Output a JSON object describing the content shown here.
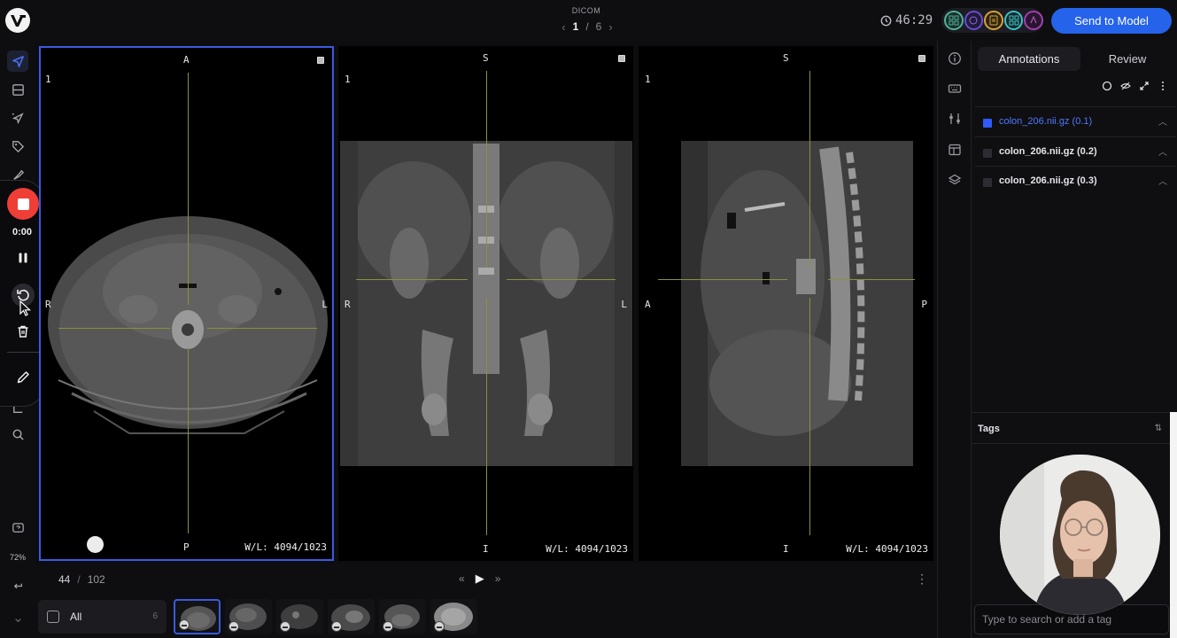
{
  "header": {
    "modality": "DICOM",
    "page_current": "1",
    "page_separator": "/",
    "page_total": "6",
    "timer": "46:29",
    "send_button": "Send to Model"
  },
  "recorder": {
    "time": "0:00"
  },
  "left_toolbar": {
    "zoom": "72%"
  },
  "viewports": [
    {
      "top": "A",
      "bottom": "P",
      "left": "R",
      "right": "L",
      "index": "1",
      "wl": "W/L: 4094/1023"
    },
    {
      "top": "S",
      "bottom": "I",
      "left": "R",
      "right": "L",
      "index": "1",
      "wl": "W/L: 4094/1023"
    },
    {
      "top": "S",
      "bottom": "I",
      "left": "A",
      "right": "P",
      "index": "1",
      "wl": "W/L: 4094/1023"
    }
  ],
  "slice_bar": {
    "current": "44",
    "separator": "/",
    "total": "102"
  },
  "thumbnails": {
    "all_label": "All",
    "all_count": "6"
  },
  "right_panel": {
    "tabs": [
      "Annotations",
      "Review"
    ],
    "layers": [
      {
        "name": "colon_206.nii.gz (0.1)",
        "color": "#2f5bff",
        "active": true
      },
      {
        "name": "colon_206.nii.gz (0.2)",
        "color": "#2c2c33",
        "active": false
      },
      {
        "name": "colon_206.nii.gz (0.3)",
        "color": "#2c2c33",
        "active": false
      }
    ],
    "tags_title": "Tags",
    "tag_placeholder": "Type to search or add a tag"
  },
  "colors": {
    "accent": "#2563eb",
    "selection": "#3b5ae0",
    "record": "#ef3e36",
    "crosshair": "#8e8f3c"
  }
}
